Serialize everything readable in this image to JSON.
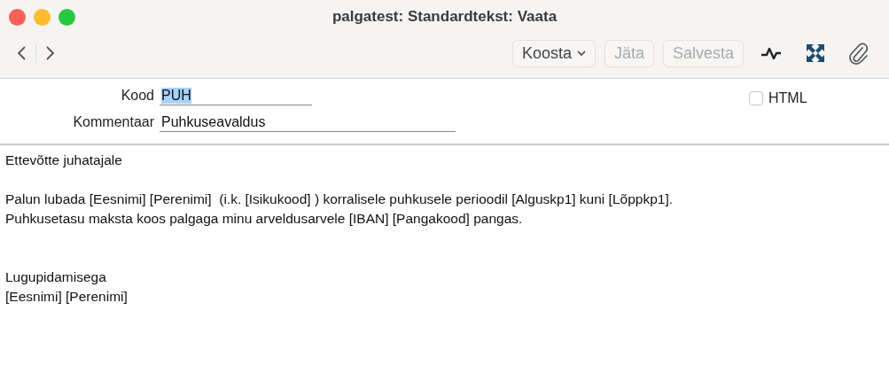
{
  "window": {
    "title": "palgatest: Standardtekst: Vaata"
  },
  "toolbar": {
    "buttons": [
      {
        "label": "Koosta",
        "kind": "menu",
        "disabled": false
      },
      {
        "label": "Jäta",
        "kind": "plain",
        "disabled": true
      },
      {
        "label": "Salvesta",
        "kind": "plain",
        "disabled": true
      }
    ]
  },
  "form": {
    "fields": [
      {
        "label": "Kood",
        "value": "PUH",
        "selected": true
      },
      {
        "label": "Kommentaar",
        "value": "Puhkuseavaldus",
        "selected": false
      }
    ],
    "html_checkbox": {
      "label": "HTML",
      "checked": false
    }
  },
  "body": {
    "lines": [
      {
        "kind": "text",
        "text": "Ettevõtte juhatajale"
      },
      {
        "kind": "blank"
      },
      {
        "kind": "text",
        "text": "Palun lubada [Eesnimi] [Perenimi]  (i.k. [Isikukood] ) korralisele puhkusele perioodil [Alguskp1] kuni [Lõppkp1]."
      },
      {
        "kind": "text",
        "text": "Puhkusetasu maksta koos palgaga minu arveldusarvele [IBAN] [Pangakood] pangas."
      },
      {
        "kind": "blank"
      },
      {
        "kind": "blank"
      },
      {
        "kind": "text",
        "text": "Lugupidamisega"
      },
      {
        "kind": "text",
        "text": "[Eesnimi] [Perenimi]"
      }
    ]
  }
}
